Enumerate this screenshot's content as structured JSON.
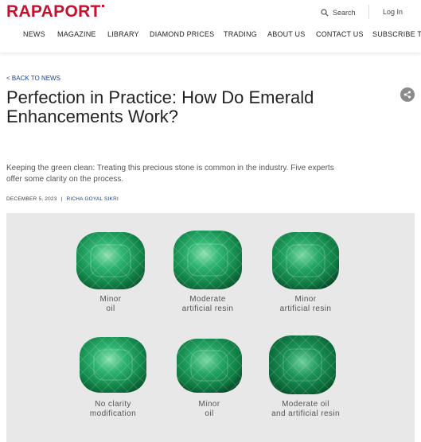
{
  "header": {
    "logo": "RAPAPORT",
    "search_label": "Search",
    "login_label": "Log In"
  },
  "nav": {
    "items": [
      "NEWS",
      "MAGAZINE",
      "LIBRARY",
      "DIAMOND PRICES",
      "TRADING",
      "ABOUT US",
      "CONTACT US",
      "SUBSCRIBE TO"
    ]
  },
  "article": {
    "back_link": "< BACK TO NEWS",
    "title": "Perfection in Practice: How Do Emerald Enhancements Work?",
    "subtitle": "Keeping the green clean: Treating this precious stone is common in the industry. Five experts offer some clarity on the process.",
    "date": "DECEMBER 5, 2023",
    "separator": "|",
    "author": "RICHA GOYAL SIKRI"
  },
  "figure": {
    "stones": [
      {
        "line1": "Minor",
        "line2": "oil",
        "color": "#1f9a5a"
      },
      {
        "line1": "Moderate",
        "line2": "artificial resin",
        "color": "#24a065"
      },
      {
        "line1": "Minor",
        "line2": "artificial resin",
        "color": "#1c945a"
      },
      {
        "line1": "No clarity",
        "line2": "modification",
        "color": "#23a063"
      },
      {
        "line1": "Minor",
        "line2": "oil",
        "color": "#22a062"
      },
      {
        "line1": "Moderate oil",
        "line2": "and artificial resin",
        "color": "#138a4c"
      }
    ]
  },
  "colors": {
    "brand": "#c8102e",
    "link": "#1d3f8a",
    "figure_bg": "#e8e8e8"
  }
}
